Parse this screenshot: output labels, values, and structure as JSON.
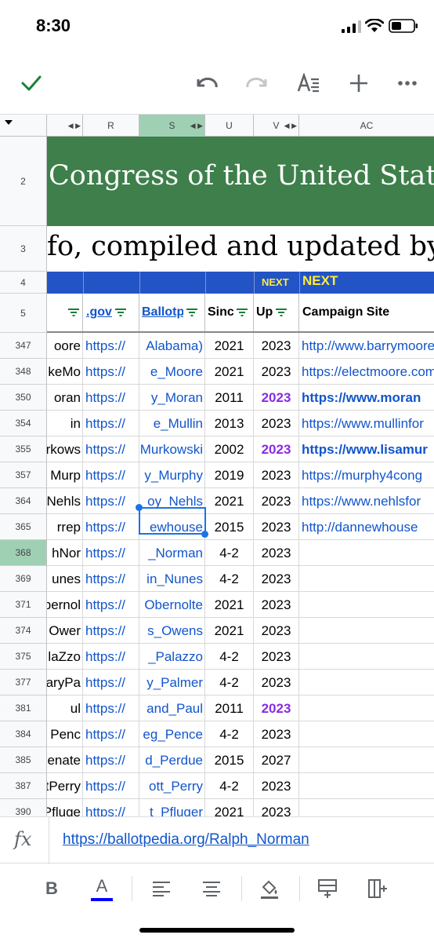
{
  "status": {
    "time": "8:30"
  },
  "toolbar": {
    "icons": [
      "check-icon",
      "undo-icon",
      "redo-icon",
      "text-format-icon",
      "insert-icon",
      "more-icon"
    ],
    "accent": "#188038"
  },
  "columns": {
    "labels": [
      "R",
      "S",
      "U",
      "V",
      "AC"
    ],
    "selected": "S"
  },
  "sheet": {
    "row2_label": "2",
    "row3_label": "3",
    "row4_label": "4",
    "row5_label": "5",
    "banner_title": "Congress of the United States",
    "banner_subtitle": "fo, compiled and updated by",
    "next_small": "NEXT",
    "next_large": "NEXT",
    "header_green": "#3e7f4b",
    "header_blue": "#2354c5",
    "headers": [
      ".gov",
      "Ballotpedia",
      "Since",
      "Up",
      "Campaign Site"
    ]
  },
  "rows": [
    {
      "num": "347",
      "name": "oore",
      "gov": "https://",
      "ballot": "Alabama)",
      "since": "2021",
      "up": "2023",
      "campaign": "http://www.barrymoore"
    },
    {
      "num": "348",
      "name": "keMo",
      "gov": "https://",
      "ballot": "e_Moore",
      "since": "2021",
      "up": "2023",
      "campaign": "https://electmoore.com"
    },
    {
      "num": "350",
      "name": "oran",
      "gov": "https://",
      "ballot": "y_Moran",
      "since": "2011",
      "up": "2023",
      "campaign": "https://www.moran"
    },
    {
      "num": "354",
      "name": "in",
      "gov": "https://",
      "ballot": "e_Mullin",
      "since": "2013",
      "up": "2023",
      "campaign": "https://www.mullinfor"
    },
    {
      "num": "355",
      "name": "rkows",
      "gov": "https://",
      "ballot": "Murkowski",
      "since": "2002",
      "up": "2023",
      "campaign": "https://www.lisamur"
    },
    {
      "num": "357",
      "name": "Murp",
      "gov": "https://",
      "ballot": "y_Murphy",
      "since": "2019",
      "up": "2023",
      "campaign": "https://murphy4cong"
    },
    {
      "num": "364",
      "name": "Nehls",
      "gov": "https://",
      "ballot": "oy_Nehls",
      "since": "2021",
      "up": "2023",
      "campaign": "https://www.nehlsfor"
    },
    {
      "num": "365",
      "name": "rrep",
      "gov": "https://",
      "ballot": "ewhouse",
      "since": "2015",
      "up": "2023",
      "campaign": "http://dannewhouse"
    },
    {
      "num": "368",
      "name": "hNor",
      "gov": "https://",
      "ballot": "_Norman",
      "since": "4-2",
      "up": "2023",
      "campaign": ""
    },
    {
      "num": "369",
      "name": "unes",
      "gov": "https://",
      "ballot": "in_Nunes",
      "since": "4-2",
      "up": "2023",
      "campaign": ""
    },
    {
      "num": "371",
      "name": "bernol",
      "gov": "https://",
      "ballot": "Obernolte",
      "since": "2021",
      "up": "2023",
      "campaign": ""
    },
    {
      "num": "374",
      "name": "Ower",
      "gov": "https://",
      "ballot": "s_Owens",
      "since": "2021",
      "up": "2023",
      "campaign": ""
    },
    {
      "num": "375",
      "name": "laZzo",
      "gov": "https://",
      "ballot": "_Palazzo",
      "since": "4-2",
      "up": "2023",
      "campaign": ""
    },
    {
      "num": "377",
      "name": "aryPa",
      "gov": "https://",
      "ballot": "y_Palmer",
      "since": "4-2",
      "up": "2023",
      "campaign": ""
    },
    {
      "num": "381",
      "name": "ul",
      "gov": "https://",
      "ballot": "and_Paul",
      "since": "2011",
      "up": "2023",
      "campaign": ""
    },
    {
      "num": "384",
      "name": "Penc",
      "gov": "https://",
      "ballot": "eg_Pence",
      "since": "4-2",
      "up": "2023",
      "campaign": ""
    },
    {
      "num": "385",
      "name": "enate",
      "gov": "https://",
      "ballot": "d_Perdue",
      "since": "2015",
      "up": "2027",
      "campaign": ""
    },
    {
      "num": "387",
      "name": "tPerry",
      "gov": "https://",
      "ballot": "ott_Perry",
      "since": "4-2",
      "up": "2023",
      "campaign": ""
    },
    {
      "num": "390",
      "name": "Pfluge",
      "gov": "https://",
      "ballot": "t_Pfluger",
      "since": "2021",
      "up": "2023",
      "campaign": ""
    }
  ],
  "highlights": {
    "purple_up_rows": [
      "350",
      "355",
      "381"
    ],
    "bold_campaign_rows": [
      "350",
      "355"
    ],
    "purple": "#8a2be2",
    "selected_row": "368",
    "selected_fill": "#9fd0b4"
  },
  "formula_bar": {
    "label": "fx",
    "value": "https://ballotpedia.org/Ralph_Norman",
    "link_color": "#1155cc"
  },
  "format_bar": {
    "icons": [
      "bold-icon",
      "text-color-icon",
      "align-left-icon",
      "align-center-icon",
      "fill-color-icon",
      "insert-row-icon",
      "insert-column-icon"
    ],
    "bold_label": "B",
    "text_color_label": "A",
    "text_color_bar": "#0000ff"
  }
}
